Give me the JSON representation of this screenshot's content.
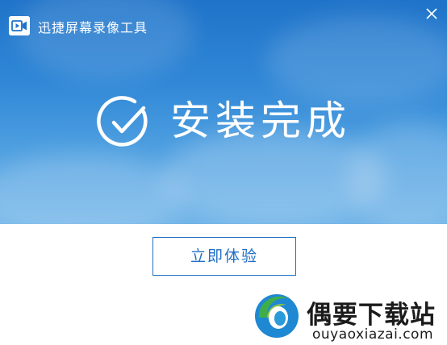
{
  "window": {
    "title": "迅捷屏幕录像工具",
    "logo_icon": "video-camera-icon",
    "close_icon": "close-icon",
    "theme_color": "#1f73c9"
  },
  "status": {
    "check_icon": "check-circle-icon",
    "message": "安装完成"
  },
  "actions": {
    "primary_label": "立即体验",
    "primary_color": "#1f6fc5"
  },
  "watermark": {
    "name": "偶要下载站",
    "url": "ouyaoxiazai.com",
    "logo_icon": "swirl-logo-icon"
  }
}
